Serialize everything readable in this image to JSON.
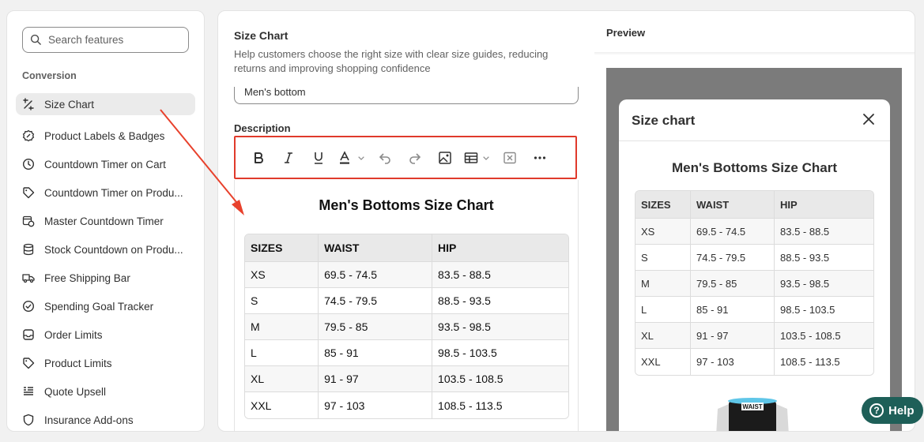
{
  "sidebar": {
    "search_placeholder": "Search features",
    "section_label": "Conversion",
    "items": [
      {
        "label": "Size Chart",
        "icon": "size-chart-icon",
        "active": true
      },
      {
        "label": "Product Labels & Badges",
        "icon": "badge-icon"
      },
      {
        "label": "Countdown Timer on Cart",
        "icon": "clock-icon"
      },
      {
        "label": "Countdown Timer on Produ...",
        "icon": "tag-clock-icon"
      },
      {
        "label": "Master Countdown Timer",
        "icon": "calendar-clock-icon"
      },
      {
        "label": "Stock Countdown on Produ...",
        "icon": "database-icon"
      },
      {
        "label": "Free Shipping Bar",
        "icon": "truck-icon"
      },
      {
        "label": "Spending Goal Tracker",
        "icon": "check-circle-icon"
      },
      {
        "label": "Order Limits",
        "icon": "inbox-icon"
      },
      {
        "label": "Product Limits",
        "icon": "tag-icon"
      },
      {
        "label": "Quote Upsell",
        "icon": "list-icon"
      },
      {
        "label": "Insurance Add-ons",
        "icon": "shield-icon"
      }
    ]
  },
  "editor": {
    "title": "Size Chart",
    "description": "Help customers choose the right size with clear size guides, reducing returns and improving shopping confidence",
    "name_value": "Men's bottom",
    "description_label": "Description",
    "toolbar": [
      "bold",
      "italic",
      "underline",
      "text-color",
      "undo",
      "redo",
      "image",
      "table",
      "clear-format",
      "more"
    ]
  },
  "chart": {
    "heading": "Men's Bottoms Size Chart",
    "columns": [
      "SIZES",
      "WAIST",
      "HIP"
    ],
    "rows": [
      [
        "XS",
        "69.5 - 74.5",
        "83.5 - 88.5"
      ],
      [
        "S",
        "74.5 - 79.5",
        "88.5 - 93.5"
      ],
      [
        "M",
        "79.5 - 85",
        "93.5 - 98.5"
      ],
      [
        "L",
        "85 - 91",
        "98.5 - 103.5"
      ],
      [
        "XL",
        "91 - 97",
        "103.5 - 108.5"
      ],
      [
        "XXL",
        "97 - 103",
        "108.5 - 113.5"
      ]
    ]
  },
  "preview": {
    "label": "Preview",
    "modal_title": "Size chart",
    "garment_tag": "WAIST"
  },
  "help": {
    "label": "Help"
  },
  "colors": {
    "highlight": "#e03a2b",
    "help_bg": "#1e5f58"
  }
}
